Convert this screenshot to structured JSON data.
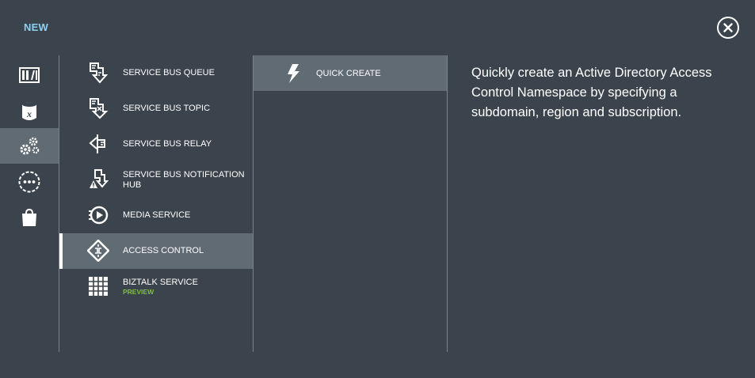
{
  "header": {
    "title": "NEW",
    "close_icon": "close-icon"
  },
  "colors": {
    "background": "#3b444c",
    "selected": "#616b73",
    "title": "#8fd0f2",
    "preview_badge": "#7ec038"
  },
  "categories": [
    {
      "icon": "web-sites-icon",
      "selected": false
    },
    {
      "icon": "data-services-icon",
      "selected": false
    },
    {
      "icon": "app-services-icon",
      "selected": true
    },
    {
      "icon": "network-services-icon",
      "selected": false
    },
    {
      "icon": "store-icon",
      "selected": false
    }
  ],
  "services": [
    {
      "label": "SERVICE BUS QUEUE",
      "icon": "service-bus-queue-icon",
      "selected": false
    },
    {
      "label": "SERVICE BUS TOPIC",
      "icon": "service-bus-topic-icon",
      "selected": false
    },
    {
      "label": "SERVICE BUS RELAY",
      "icon": "service-bus-relay-icon",
      "selected": false
    },
    {
      "label": "SERVICE BUS NOTIFICATION HUB",
      "icon": "notification-hub-icon",
      "selected": false
    },
    {
      "label": "MEDIA SERVICE",
      "icon": "media-service-icon",
      "selected": false
    },
    {
      "label": "ACCESS CONTROL",
      "icon": "access-control-icon",
      "selected": true
    },
    {
      "label": "BIZTALK SERVICE",
      "badge": "PREVIEW",
      "icon": "biztalk-icon",
      "selected": false
    }
  ],
  "quick_create": {
    "label": "QUICK CREATE",
    "icon": "lightning-icon"
  },
  "description": "Quickly create an Active Directory Access Control Namespace by specifying a subdomain, region and subscription."
}
